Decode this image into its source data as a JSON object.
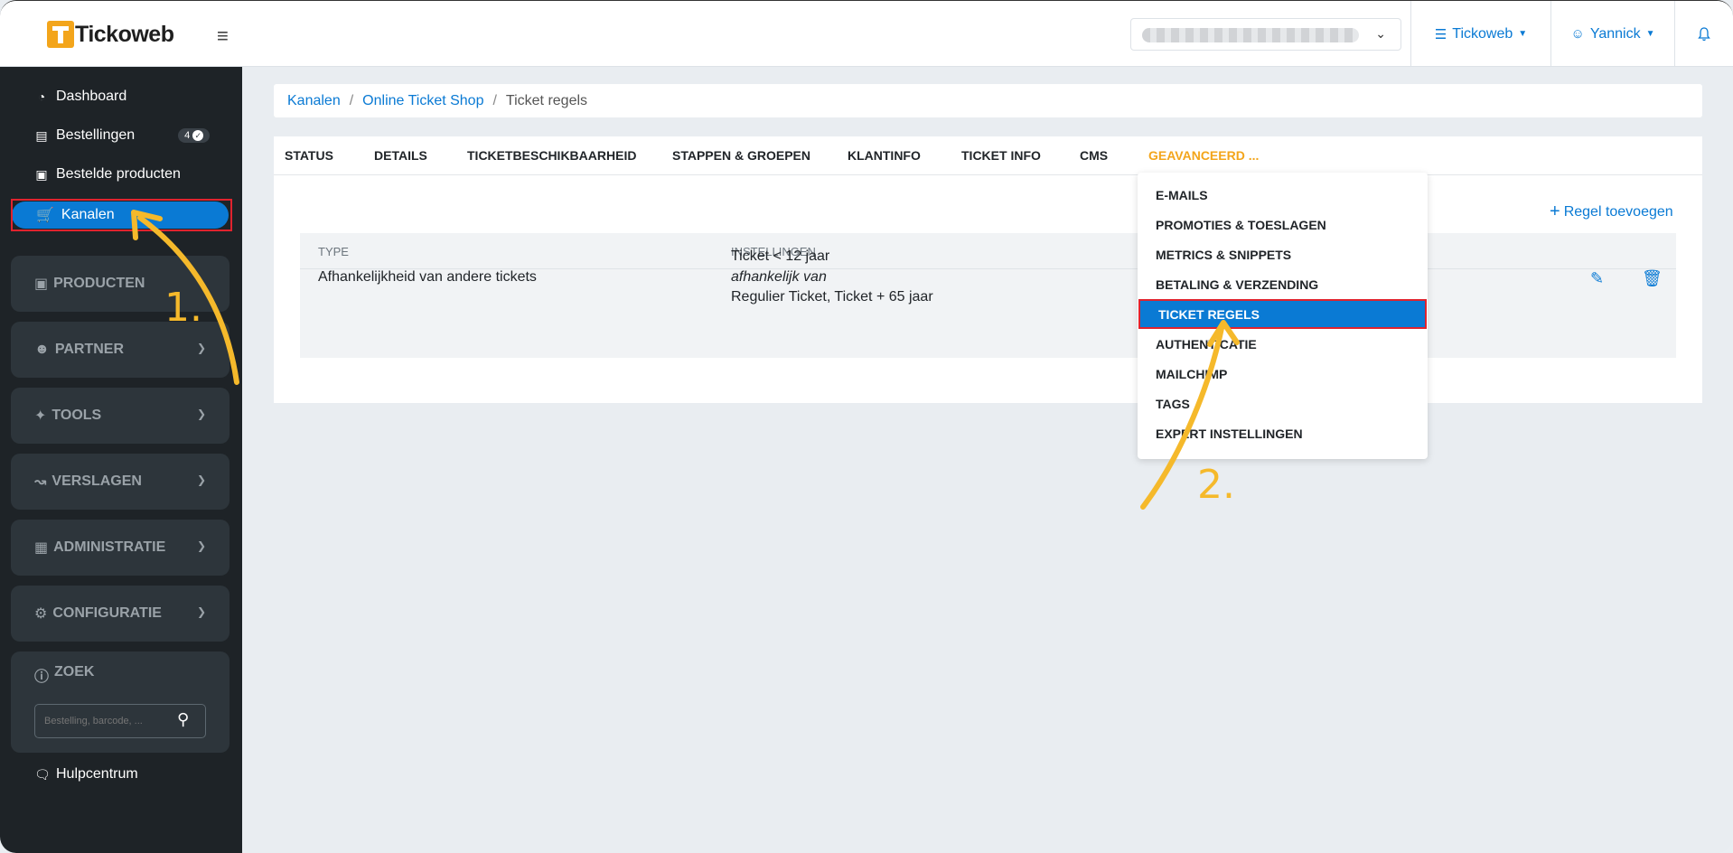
{
  "header": {
    "logo_text": "Tickoweb",
    "hamburger": "≡",
    "org_label": "Tickoweb",
    "user_label": "Yannick",
    "bell_icon": "bell-icon"
  },
  "sidebar": {
    "dashboard": "Dashboard",
    "orders": "Bestellingen",
    "orders_badge": "4",
    "ordered_products": "Bestelde producten",
    "channels": "Kanalen",
    "groups": {
      "producten": "PRODUCTEN",
      "partner": "PARTNER",
      "tools": "TOOLS",
      "verslagen": "VERSLAGEN",
      "administratie": "ADMINISTRATIE",
      "configuratie": "CONFIGURATIE"
    },
    "search_title": "ZOEK",
    "search_placeholder": "Bestelling, barcode, ...",
    "help": "Hulpcentrum"
  },
  "breadcrumb": {
    "items": [
      "Kanalen",
      "Online Ticket Shop"
    ],
    "current": "Ticket regels",
    "separator": "/"
  },
  "tabs": [
    "STATUS",
    "DETAILS",
    "TICKETBESCHIKBAARHEID",
    "STAPPEN & GROEPEN",
    "KLANTINFO",
    "TICKET INFO",
    "CMS",
    "GEAVANCEERD ..."
  ],
  "active_tab": "GEAVANCEERD ...",
  "actions": {
    "add_rule": "Regel toevoegen"
  },
  "table": {
    "columns": [
      "TYPE",
      "INSTELLINGEN"
    ],
    "rows": [
      {
        "type": "Afhankelijkheid van andere tickets",
        "setting_line1": "Ticket < 12 jaar",
        "setting_line2": "afhankelijk van",
        "setting_line3": "Regulier Ticket, Ticket + 65 jaar"
      }
    ]
  },
  "dropdown": {
    "items": [
      "E-MAILS",
      "PROMOTIES & TOESLAGEN",
      "METRICS & SNIPPETS",
      "BETALING & VERZENDING",
      "TICKET REGELS",
      "AUTHENTICATIE",
      "MAILCHIMP",
      "TAGS",
      "EXPERT INSTELLINGEN"
    ],
    "selected": "TICKET REGELS"
  },
  "annotations": {
    "step1": "1.",
    "step2": "2."
  },
  "colors": {
    "accent": "#0a7ad4",
    "active_tab": "#f3a51b",
    "highlight_border": "#e0232e",
    "arrow": "#f5b92b",
    "sidebar_bg": "#1e2327"
  }
}
